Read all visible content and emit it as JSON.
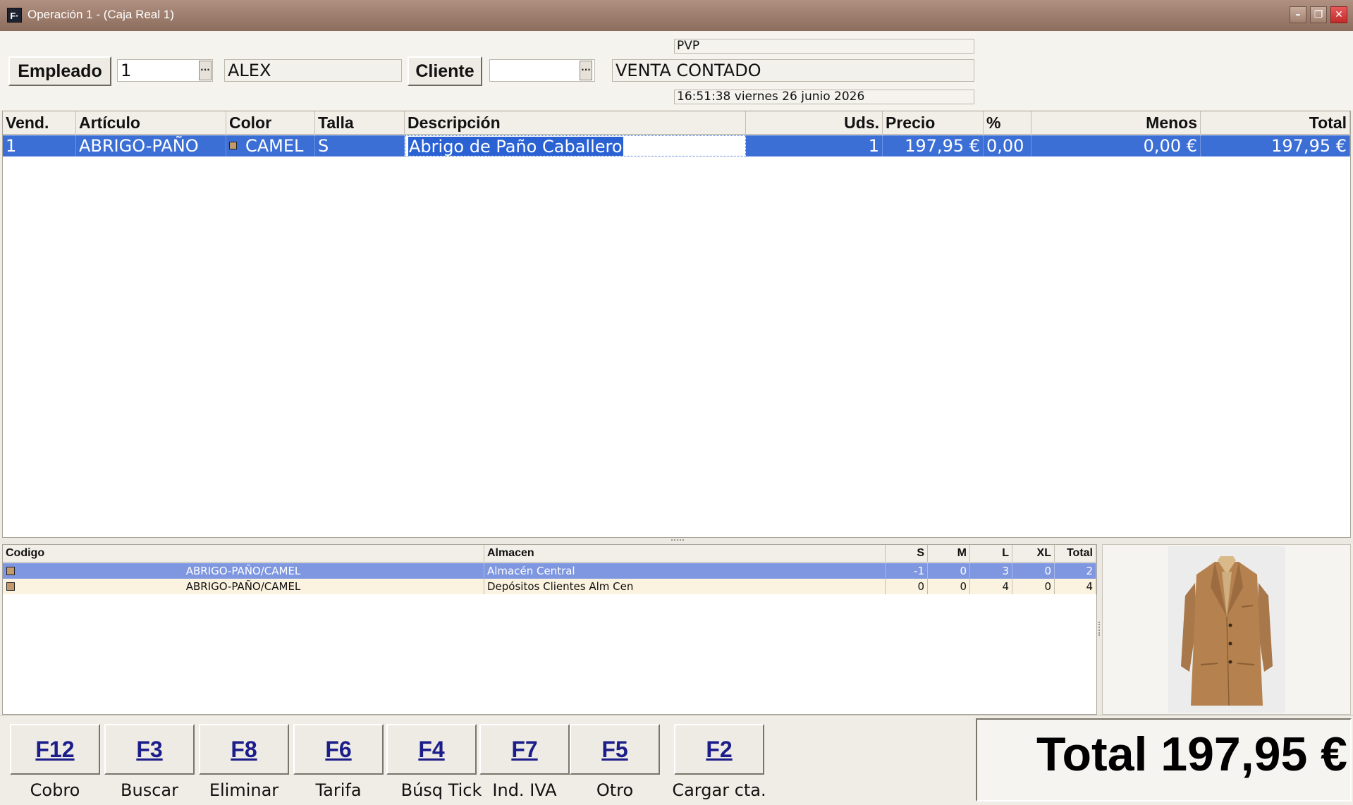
{
  "window": {
    "app_icon": "F·",
    "title": "Operación 1 - (Caja Real 1)",
    "minimize_icon": "minimize-icon",
    "restore_icon": "restore-icon",
    "close_icon": "close-icon"
  },
  "header": {
    "empleado_label": "Empleado",
    "empleado_code": "1",
    "empleado_name": "ALEX",
    "cliente_label": "Cliente",
    "cliente_code": "",
    "cliente_name": "VENTA CONTADO",
    "tarifa": "PVP",
    "datetime": "16:51:38 viernes 26 junio 2026",
    "ellipsis": "···"
  },
  "grid": {
    "columns": [
      "Vend.",
      "Artículo",
      "Color",
      "Talla",
      "Descripción",
      "Uds.",
      "Precio",
      "%",
      "Menos",
      "Total"
    ],
    "rows": [
      {
        "vend": "1",
        "articulo": "ABRIGO-PAÑO",
        "color": "CAMEL",
        "color_hex": "#c49a6c",
        "talla": "S",
        "descripcion": "Abrigo de Paño Caballero",
        "uds": "1",
        "precio": "197,95 €",
        "pct": "0,00 '",
        "menos": "0,00 €",
        "total": "197,95 €"
      }
    ]
  },
  "stock": {
    "columns": [
      "Codigo",
      "Almacen",
      "S",
      "M",
      "L",
      "XL",
      "Total"
    ],
    "rows": [
      {
        "codigo": "ABRIGO-PAÑO/CAMEL",
        "almacen": "Almacén Central",
        "s": "-1",
        "m": "0",
        "l": "3",
        "xl": "0",
        "total": "2",
        "selected": true
      },
      {
        "codigo": "ABRIGO-PAÑO/CAMEL",
        "almacen": "Depósitos Clientes Alm Cen",
        "s": "0",
        "m": "0",
        "l": "4",
        "xl": "0",
        "total": "4",
        "selected": false
      }
    ]
  },
  "product_image": "coat-image",
  "function_keys": [
    {
      "key": "F12",
      "caption": "Cobro"
    },
    {
      "key": "F3",
      "caption": "Buscar"
    },
    {
      "key": "F8",
      "caption": "Eliminar"
    },
    {
      "key": "F6",
      "caption": "Tarifa"
    },
    {
      "key": "F4",
      "caption": "Búsq Tick"
    },
    {
      "key": "F7",
      "caption": "Ind. IVA"
    },
    {
      "key": "F5",
      "caption": "Otro"
    },
    {
      "key": "F2",
      "caption": "Cargar cta."
    }
  ],
  "total": "Total 197,95 €",
  "colors": {
    "selection": "#3c6fd6",
    "stock_selection": "#7f97e0",
    "function_key_text": "#1b1d8a",
    "camel_swatch": "#c49a6c"
  }
}
